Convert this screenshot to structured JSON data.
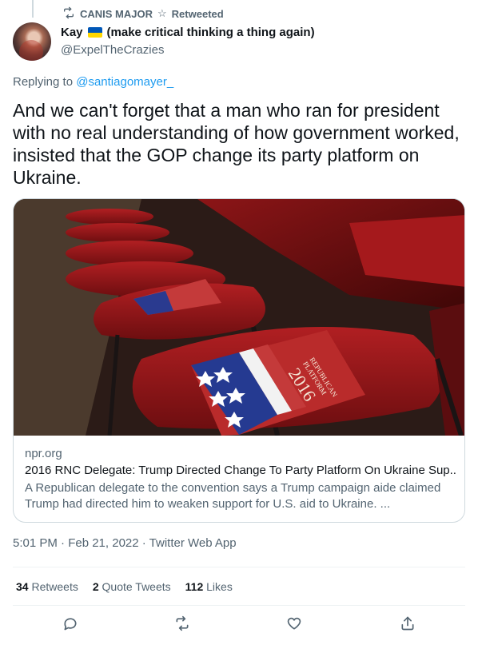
{
  "retweet": {
    "by": "CANIS MAJOR",
    "star": "☆",
    "label": "Retweeted"
  },
  "author": {
    "name": "Kay",
    "name_suffix": "(make critical thinking a thing again)",
    "handle": "@ExpelTheCrazies"
  },
  "replying": {
    "prefix": "Replying to",
    "to": "@santiagomayer_"
  },
  "tweet": {
    "text": "And we can't forget that a man who ran for president with no real understanding of how government worked, insisted that the GOP change its party platform on Ukraine."
  },
  "card": {
    "image_text_line1": "REPUBLICAN",
    "image_text_line2": "PLATFORM",
    "image_text_year": "2016",
    "domain": "npr.org",
    "title": "2016 RNC Delegate: Trump Directed Change To Party Platform On Ukraine Sup...",
    "description": "A Republican delegate to the convention says a Trump campaign aide claimed Trump had directed him to weaken support for U.S. aid to Ukraine. ..."
  },
  "meta": {
    "time": "5:01 PM · Feb 21, 2022 · Twitter Web App"
  },
  "stats": {
    "retweets_count": "34",
    "retweets_label": "Retweets",
    "quotes_count": "2",
    "quotes_label": "Quote Tweets",
    "likes_count": "112",
    "likes_label": "Likes"
  },
  "colors": {
    "link": "#1d9bf0",
    "muted": "#536471",
    "flag_blue": "#0057b7",
    "flag_yellow": "#ffd700"
  }
}
